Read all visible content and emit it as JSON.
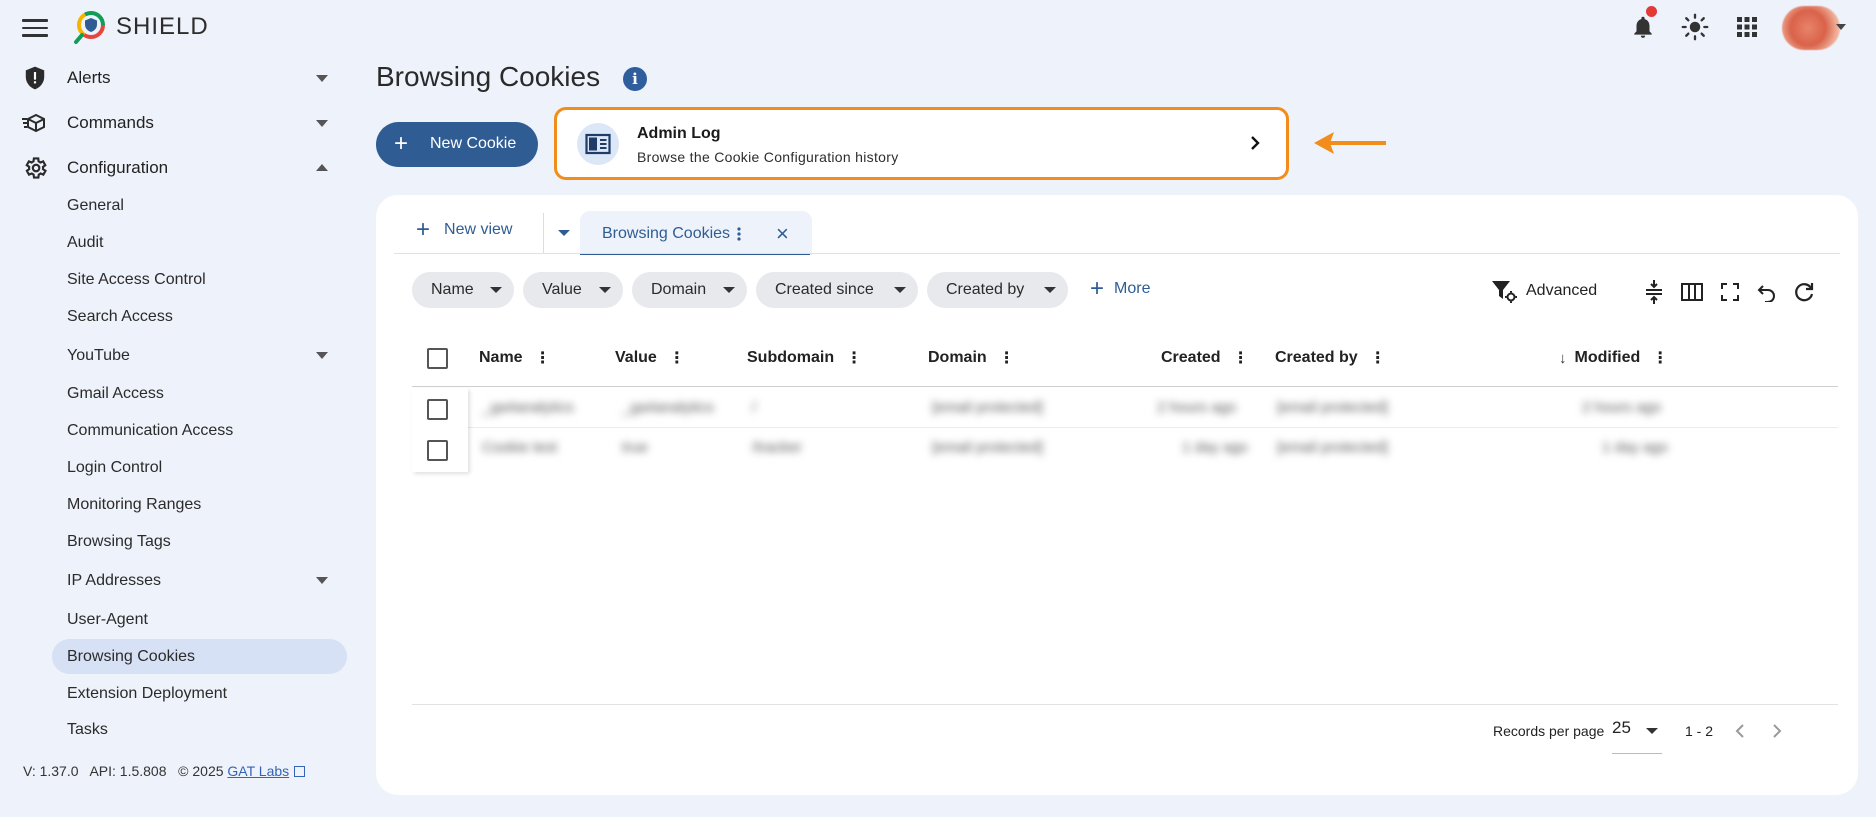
{
  "app": {
    "brand": "SHIELD"
  },
  "header": {
    "notification_dot_color": "#e53935"
  },
  "sidebar": {
    "groups": {
      "alerts": "Alerts",
      "commands": "Commands",
      "configuration": "Configuration"
    },
    "items": [
      {
        "label": "General"
      },
      {
        "label": "Audit"
      },
      {
        "label": "Site Access Control"
      },
      {
        "label": "Search Access"
      },
      {
        "label": "YouTube"
      },
      {
        "label": "Gmail Access"
      },
      {
        "label": "Communication Access"
      },
      {
        "label": "Login Control"
      },
      {
        "label": "Monitoring Ranges"
      },
      {
        "label": "Browsing Tags"
      },
      {
        "label": "IP Addresses"
      },
      {
        "label": "User-Agent"
      },
      {
        "label": "Browsing Cookies"
      },
      {
        "label": "Extension Deployment"
      },
      {
        "label": "Tasks"
      }
    ],
    "active_item": "Browsing Cookies",
    "version": "V: 1.37.0",
    "api": "API: 1.5.808",
    "copyright": "© 2025",
    "company_link": "GAT Labs"
  },
  "page": {
    "title": "Browsing Cookies",
    "info_symbol": "i",
    "new_button": "New Cookie",
    "admin_card": {
      "title": "Admin Log",
      "subtitle": "Browse the Cookie Configuration history"
    }
  },
  "views": {
    "new_view": "New view",
    "active_tab": "Browsing Cookies"
  },
  "filters": {
    "chips": [
      "Name",
      "Value",
      "Domain",
      "Created since",
      "Created by"
    ],
    "more": "More",
    "advanced": "Advanced"
  },
  "table": {
    "columns": [
      "Name",
      "Value",
      "Subdomain",
      "Domain",
      "Created",
      "Created by",
      "Modified"
    ],
    "sorted_column": "Modified",
    "sort_direction": "descending",
    "rows": [
      {
        "name": "_ga4analytics",
        "value": "_ga4analytics",
        "subdomain": "/",
        "domain": "[email protected]",
        "created": "2 hours ago",
        "created_by": "[email protected]",
        "modified": "2 hours ago"
      },
      {
        "name": "Cookie test",
        "value": "true",
        "subdomain": "/tracker",
        "domain": "[email protected]",
        "created": "1 day ago",
        "created_by": "[email protected]",
        "modified": "1 day ago"
      }
    ]
  },
  "pagination": {
    "records_per_page_label": "Records per page",
    "records_per_page": "25",
    "range": "1 - 2"
  },
  "colors": {
    "primary": "#2f5d93",
    "highlight_outline": "#f28c1a",
    "background": "#eef2fa",
    "active_nav": "#d7e1f5"
  }
}
